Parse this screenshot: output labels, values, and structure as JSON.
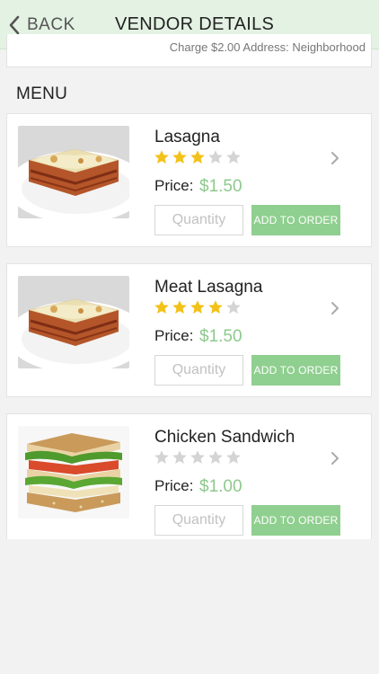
{
  "header": {
    "back_label": "BACK",
    "title": "VENDOR DETAILS",
    "bg_color": "#e4f2e4"
  },
  "vendor_info": {
    "partial_text": "Charge $2.00 Address: Neighborhood"
  },
  "menu": {
    "section_title": "MENU",
    "quantity_placeholder": "Quantity",
    "add_label": "ADD TO ORDER",
    "price_label": "Price:",
    "items": [
      {
        "name": "Lasagna",
        "rating": 3,
        "price": "$1.50",
        "image": "lasagna-photo"
      },
      {
        "name": "Meat Lasagna",
        "rating": 4,
        "price": "$1.50",
        "image": "lasagna-photo"
      },
      {
        "name": "Chicken Sandwich",
        "rating": 0,
        "price": "$1.00",
        "image": "sandwich-photo"
      }
    ]
  },
  "colors": {
    "accent": "#8fcf8f",
    "price": "#8dc98d",
    "star_on": "#f2c21a",
    "star_off": "#d4d4d4"
  }
}
